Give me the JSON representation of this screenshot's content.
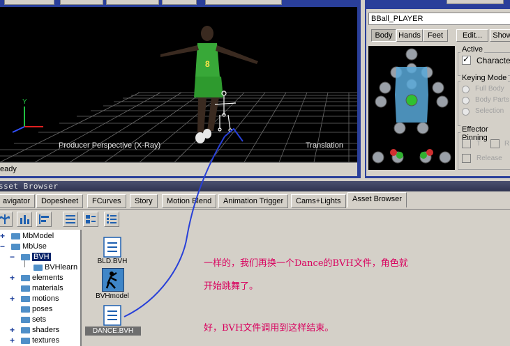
{
  "viewer": {
    "perspective_label": "Producer Perspective (X-Ray)",
    "mode_label": "Translation",
    "status_text": "eady",
    "axis_y": "Y"
  },
  "character_panel": {
    "name_field": "BBall_PLAYER",
    "tabs": [
      "Body",
      "Hands",
      "Feet"
    ],
    "edit_button": "Edit...",
    "show_button": "Show",
    "active_group": {
      "title": "Active",
      "checkbox_label": "Character"
    },
    "keying_mode": {
      "title": "Keying Mode",
      "options": [
        "Full Body",
        "Body Parts",
        "Selection"
      ]
    },
    "effector_pinning": {
      "title": "Effector Pinning",
      "options": [
        "T",
        "R",
        "Release"
      ]
    }
  },
  "asset_browser": {
    "title": "sset Browser",
    "tabs": [
      "avigator",
      "Dopesheet",
      "FCurves",
      "Story",
      "Motion Blend",
      "Animation Trigger",
      "Cams+Lights",
      "Asset Browser"
    ],
    "active_tab": "Asset Browser",
    "tree": [
      {
        "label": "MbModel",
        "expander": "+"
      },
      {
        "label": "MbUse",
        "expander": "-"
      },
      {
        "label": "BVH",
        "expander": "-",
        "selected": true
      },
      {
        "label": "BVHlearn",
        "expander": ""
      },
      {
        "label": "elements",
        "expander": "+"
      },
      {
        "label": "materials",
        "expander": ""
      },
      {
        "label": "motions",
        "expander": "+"
      },
      {
        "label": "poses",
        "expander": ""
      },
      {
        "label": "sets",
        "expander": ""
      },
      {
        "label": "shaders",
        "expander": "+"
      },
      {
        "label": "textures",
        "expander": "+"
      }
    ],
    "files": [
      {
        "name": "BLD.BVH",
        "icon": "document-icon"
      },
      {
        "name": "BVHmodel",
        "icon": "character-icon"
      },
      {
        "name": "DANCE.BVH",
        "icon": "document-icon",
        "selected": true
      }
    ]
  },
  "annotations": {
    "line1": "一样的，我们再换一个Dance的BVH文件，角色就",
    "line2": "开始跳舞了。",
    "line3": "好，BVH文件调用到这样结束。"
  },
  "colors": {
    "annotation": "#d9005e",
    "arrow": "#2840d8",
    "selection": "#0a246a"
  }
}
